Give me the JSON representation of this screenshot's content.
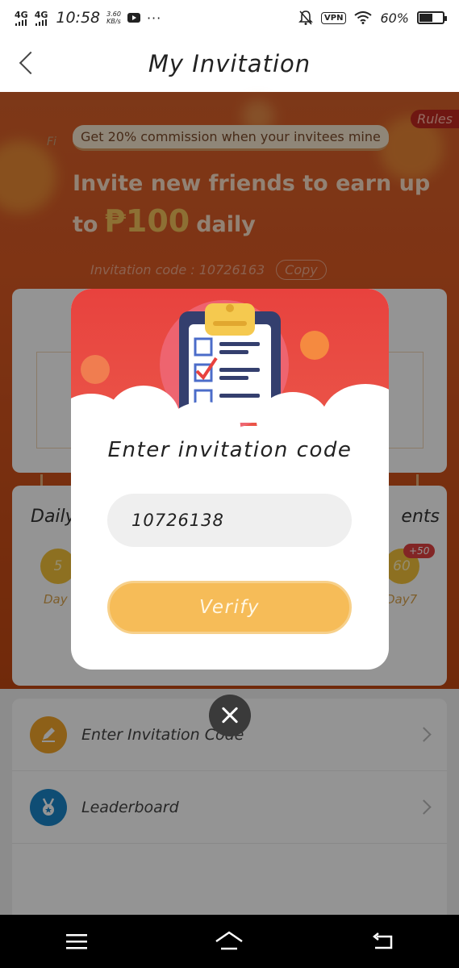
{
  "status_bar": {
    "network1": "4G",
    "network2": "4G",
    "time": "10:58",
    "speed_value": "3.60",
    "speed_unit": "KB/s",
    "more": "···",
    "vpn": "VPN",
    "battery_percent": "60%",
    "battery_level": 0.6
  },
  "header": {
    "title": "My Invitation"
  },
  "hero": {
    "rules_label": "Rules",
    "commission_text": "Get 20% commission when your invitees mine",
    "headline_line1": "Invite new friends to earn up",
    "headline_prefix": "to",
    "headline_amount": "₱100",
    "headline_suffix": "daily",
    "invitation_code_text": "Invitation code : 10726163",
    "copy_label": "Copy"
  },
  "background_cards": {
    "partial_label": "Fi",
    "daily_label": "Daily",
    "events_label": "ents",
    "left_coin_value": "5",
    "left_day_label": "Day",
    "right_coin_value": "60",
    "right_day_label": "Day7",
    "bonus_badge": "+50"
  },
  "menu": {
    "items": [
      {
        "label": "Enter Invitation Code",
        "icon": "pencil-icon",
        "color": "#f3a52a"
      },
      {
        "label": "Leaderboard",
        "icon": "medal-icon",
        "color": "#1b86c9"
      }
    ]
  },
  "modal": {
    "title": "Enter invitation code",
    "input_value": "10726138",
    "verify_label": "Verify"
  },
  "nav": {
    "menu_icon": "menu-icon",
    "home_icon": "home-icon",
    "back_icon": "back-icon"
  },
  "colors": {
    "hero_orange": "#d8612a",
    "modal_red": "#e8423e",
    "verify_yellow": "#f6bc58"
  }
}
